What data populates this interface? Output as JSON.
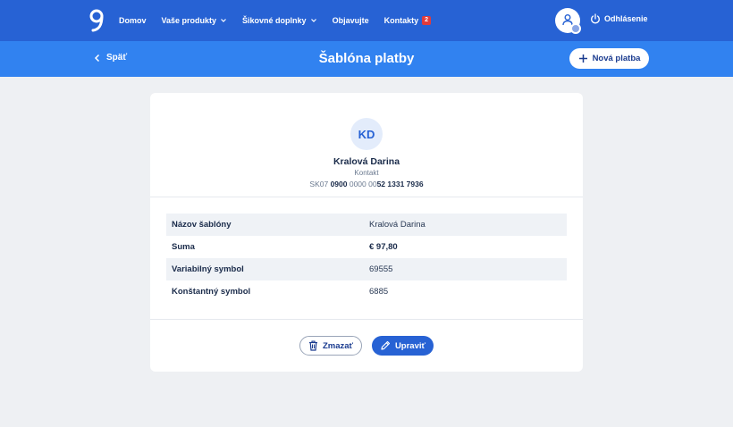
{
  "nav": {
    "logo_icon": "brand-logo",
    "items": [
      {
        "label": "Domov",
        "has_dropdown": false
      },
      {
        "label": "Vaše produkty",
        "has_dropdown": true
      },
      {
        "label": "Šikovné doplnky",
        "has_dropdown": true
      },
      {
        "label": "Objavujte",
        "has_dropdown": false
      },
      {
        "label": "Kontakty",
        "has_dropdown": false,
        "badge": "2"
      }
    ],
    "logout_label": "Odhlásenie"
  },
  "subheader": {
    "back_label": "Späť",
    "title": "Šablóna platby",
    "new_payment_label": "Nová platba"
  },
  "contact": {
    "initials": "KD",
    "name": "Kralová Darina",
    "type": "Kontakt",
    "iban_prefix": "SK07 ",
    "iban_bold1": "0900",
    "iban_mid": " 0000 00",
    "iban_bold2": "52 1331 7936"
  },
  "details": [
    {
      "label": "Názov šablóny",
      "value": "Kralová Darina"
    },
    {
      "label": "Suma",
      "value": "€ 97,80"
    },
    {
      "label": "Variabilný symbol",
      "value": "69555"
    },
    {
      "label": "Konštantný symbol",
      "value": "6885"
    }
  ],
  "actions": {
    "delete_label": "Zmazať",
    "edit_label": "Upraviť"
  },
  "colors": {
    "nav_bg": "#2762d4",
    "subheader_bg": "#3182f0",
    "page_bg": "#eef0f3",
    "accent": "#2762d4",
    "badge": "#e23b3b"
  }
}
